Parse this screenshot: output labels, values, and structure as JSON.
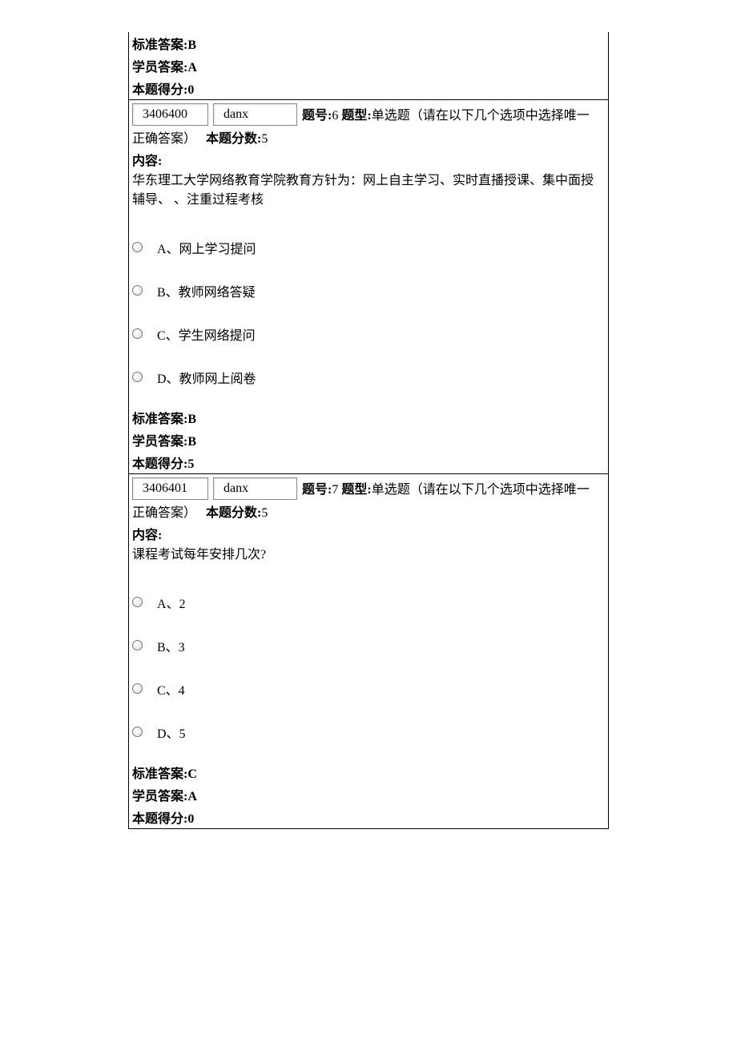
{
  "prev_tail": {
    "std_answer_label": "标准答案:",
    "std_answer_value": "B",
    "student_answer_label": "学员答案:",
    "student_answer_value": "A",
    "score_label": "本题得分:",
    "score_value": "0"
  },
  "q6": {
    "id": "3406400",
    "qtype_code": "danx",
    "meta_prefix": "题号:",
    "qnum": "6",
    "type_label": " 题型:",
    "type_text": "单选题（请在以下几个选项中选择唯一",
    "meta_cont": "正确答案）",
    "points_label": "本题分数:",
    "points_value": "5",
    "content_label": "内容:",
    "content_text": "华东理工大学网络教育学院教育方针为：网上自主学习、实时直播授课、集中面授辅导、 、注重过程考核",
    "options": {
      "a": "A、网上学习提问",
      "b": "B、教师网络答疑",
      "c": "C、学生网络提问",
      "d": "D、教师网上阅卷"
    },
    "std_answer_label": "标准答案:",
    "std_answer_value": "B",
    "student_answer_label": "学员答案:",
    "student_answer_value": "B",
    "score_label": "本题得分:",
    "score_value": "5"
  },
  "q7": {
    "id": "3406401",
    "qtype_code": "danx",
    "meta_prefix": "题号:",
    "qnum": "7",
    "type_label": " 题型:",
    "type_text": "单选题（请在以下几个选项中选择唯一",
    "meta_cont": "正确答案）",
    "points_label": "本题分数:",
    "points_value": "5",
    "content_label": "内容:",
    "content_text": "课程考试每年安排几次?",
    "options": {
      "a": "A、2",
      "b": "B、3",
      "c": "C、4",
      "d": "D、5"
    },
    "std_answer_label": "标准答案:",
    "std_answer_value": "C",
    "student_answer_label": "学员答案:",
    "student_answer_value": "A",
    "score_label": "本题得分:",
    "score_value": "0"
  }
}
